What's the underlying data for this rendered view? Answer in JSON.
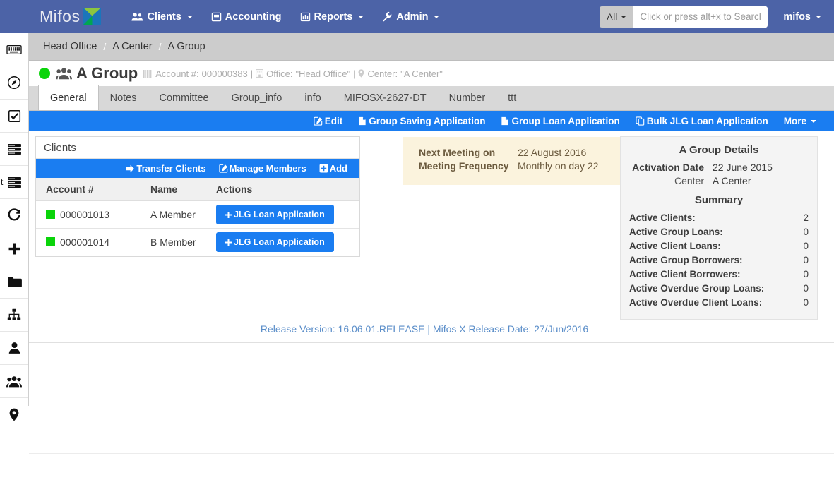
{
  "topnav": {
    "brand": "Mifos",
    "brand_logo_icon": "mifos-x-logo",
    "items": [
      {
        "label": "Clients",
        "icon": "users-icon",
        "caret": true
      },
      {
        "label": "Accounting",
        "icon": "calculator-icon",
        "caret": false
      },
      {
        "label": "Reports",
        "icon": "bar-chart-icon",
        "caret": true
      },
      {
        "label": "Admin",
        "icon": "wrench-icon",
        "caret": true
      }
    ],
    "search": {
      "scope_label": "All",
      "placeholder": "Click or press alt+x to Search",
      "value": ""
    },
    "user": "mifos"
  },
  "sidebar": {
    "items": [
      {
        "name": "keyboard-icon",
        "badge": ""
      },
      {
        "name": "compass-icon",
        "badge": ""
      },
      {
        "name": "check-square-icon",
        "badge": ""
      },
      {
        "name": "server-icon",
        "badge": ""
      },
      {
        "name": "server-text-icon",
        "badge": "t"
      },
      {
        "name": "refresh-icon",
        "badge": ""
      },
      {
        "name": "plus-icon",
        "badge": ""
      },
      {
        "name": "folder-icon",
        "badge": ""
      },
      {
        "name": "sitemap-icon",
        "badge": ""
      },
      {
        "name": "user-icon",
        "badge": ""
      },
      {
        "name": "users-icon",
        "badge": ""
      },
      {
        "name": "map-marker-icon",
        "badge": ""
      }
    ]
  },
  "breadcrumb": {
    "items": [
      "Head Office",
      "A Center",
      "A Group"
    ],
    "separator": "/"
  },
  "page_head": {
    "status": "active",
    "status_color": "#0ad40a",
    "title": "A Group",
    "account_label": "Account #:",
    "account_number": "000000383",
    "office_label": "Office:",
    "office_value": "\"Head Office\"",
    "center_label": "Center:",
    "center_value": "\"A Center\"",
    "sep": "|"
  },
  "tabs": {
    "active_index": 0,
    "items": [
      "General",
      "Notes",
      "Committee",
      "Group_info",
      "info",
      "MIFOSX-2627-DT",
      "Number",
      "ttt"
    ]
  },
  "actionbar": {
    "items": [
      {
        "label": "Edit",
        "icon": "edit-icon"
      },
      {
        "label": "Group Saving Application",
        "icon": "file-icon"
      },
      {
        "label": "Group Loan Application",
        "icon": "file-icon"
      },
      {
        "label": "Bulk JLG Loan Application",
        "icon": "copy-icon"
      },
      {
        "label": "More",
        "icon": "",
        "caret": true
      }
    ]
  },
  "clients_panel": {
    "title": "Clients",
    "actions": [
      {
        "label": "Transfer Clients",
        "icon": "arrow-right-icon"
      },
      {
        "label": "Manage Members",
        "icon": "edit-icon"
      },
      {
        "label": "Add",
        "icon": "plus-square-icon"
      }
    ],
    "columns": [
      "Account #",
      "Name",
      "Actions"
    ],
    "rows": [
      {
        "account": "000001013",
        "name": "A Member",
        "action_label": "JLG Loan Application",
        "status_color": "#0ad40a"
      },
      {
        "account": "000001014",
        "name": "B Member",
        "action_label": "JLG Loan Application",
        "status_color": "#0ad40a"
      }
    ]
  },
  "meeting_box": {
    "rows": [
      {
        "label": "Next Meeting on",
        "value": "22 August 2016"
      },
      {
        "label": "Meeting Frequency",
        "value": "Monthly on day 22"
      }
    ]
  },
  "details_panel": {
    "title": "A Group Details",
    "rows": [
      {
        "label": "Activation Date",
        "value": "22 June 2015",
        "bold": true
      },
      {
        "label": "Center",
        "value": "A Center",
        "bold": false
      }
    ],
    "summary_title": "Summary",
    "summary": [
      {
        "label": "Active Clients:",
        "value": "2"
      },
      {
        "label": "Active Group Loans:",
        "value": "0"
      },
      {
        "label": "Active Client Loans:",
        "value": "0"
      },
      {
        "label": "Active Group Borrowers:",
        "value": "0"
      },
      {
        "label": "Active Client Borrowers:",
        "value": "0"
      },
      {
        "label": "Active Overdue Group Loans:",
        "value": "0"
      },
      {
        "label": "Active Overdue Client Loans:",
        "value": "0"
      }
    ]
  },
  "footer": {
    "release": "Release Version: 16.06.01.RELEASE | Mifos X Release Date: 27/Jun/2016"
  },
  "colors": {
    "nav_blue": "#4c63a7",
    "action_blue": "#1a7df1",
    "breadcrumb_gray": "#cccccc",
    "tab_gray": "#d8d8d8",
    "meeting_cream": "#fbf3dd",
    "details_gray": "#f4f4f4",
    "status_green": "#0ad40a",
    "link_blue": "#5b8ec9"
  }
}
